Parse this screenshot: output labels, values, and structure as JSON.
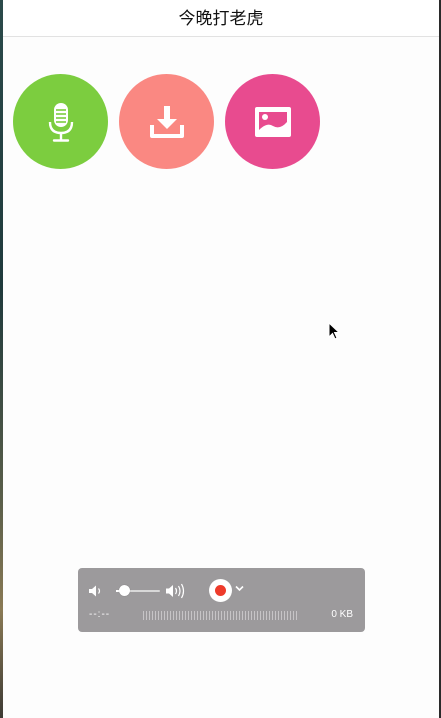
{
  "header": {
    "title": "今晚打老虎"
  },
  "actions": [
    {
      "name": "record",
      "icon": "microphone-icon",
      "color": "#7ccd3f"
    },
    {
      "name": "download",
      "icon": "download-icon",
      "color": "#fa8882"
    },
    {
      "name": "image",
      "icon": "image-icon",
      "color": "#e84b8f"
    }
  ],
  "recorder": {
    "volume_level": 0.2,
    "time": "--:--",
    "size": "0 KB",
    "record_color": "#ee3b2b",
    "icons": [
      "volume-low-icon",
      "volume-high-icon",
      "record-icon",
      "chevron-down-icon"
    ]
  }
}
